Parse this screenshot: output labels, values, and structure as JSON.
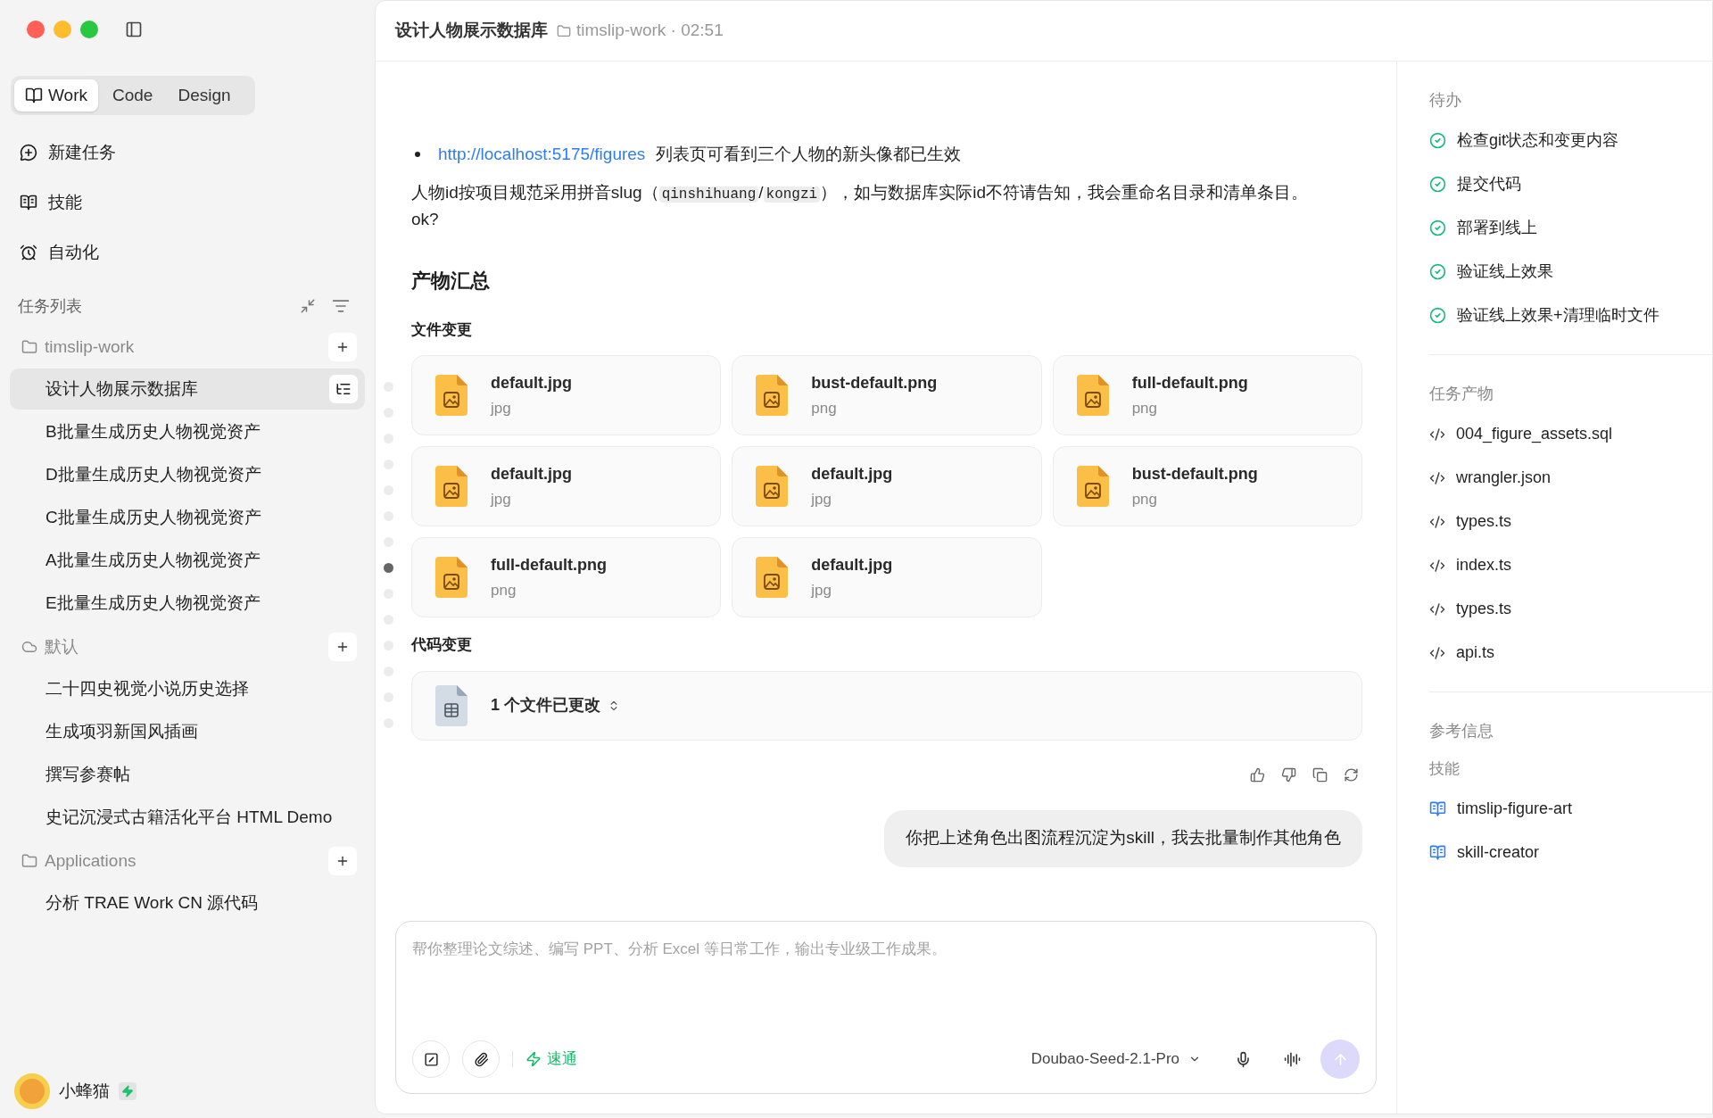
{
  "sidebar": {
    "tabs": [
      {
        "label": "Work",
        "selected": true
      },
      {
        "label": "Code",
        "selected": false
      },
      {
        "label": "Design",
        "selected": false
      }
    ],
    "nav": [
      {
        "kind": "new-task",
        "label": "新建任务"
      },
      {
        "kind": "skills",
        "label": "技能"
      },
      {
        "kind": "automation",
        "label": "自动化"
      }
    ],
    "task_list": {
      "title": "任务列表",
      "groups": [
        {
          "kind": "folder",
          "name": "timslip-work",
          "tasks": [
            {
              "title": "设计人物展示数据库",
              "selected": true
            },
            {
              "title": "B批量生成历史人物视觉资产",
              "selected": false
            },
            {
              "title": "D批量生成历史人物视觉资产",
              "selected": false
            },
            {
              "title": "C批量生成历史人物视觉资产",
              "selected": false
            },
            {
              "title": "A批量生成历史人物视觉资产",
              "selected": false
            },
            {
              "title": "E批量生成历史人物视觉资产",
              "selected": false
            }
          ]
        },
        {
          "kind": "cloud",
          "name": "默认",
          "tasks": [
            {
              "title": "二十四史视觉小说历史选择",
              "selected": false
            },
            {
              "title": "生成项羽新国风插画",
              "selected": false
            },
            {
              "title": "撰写参赛帖",
              "selected": false
            },
            {
              "title": "史记沉浸式古籍活化平台 HTML Demo",
              "selected": false
            }
          ]
        },
        {
          "kind": "folder",
          "name": "Applications",
          "tasks": [
            {
              "title": "分析 TRAE Work CN 源代码",
              "selected": false
            }
          ]
        }
      ]
    },
    "user": {
      "name": "小蜂猫"
    }
  },
  "header": {
    "title": "设计人物展示数据库",
    "project": "timslip-work · 02:51"
  },
  "timeline": [
    {
      "selected": false
    },
    {
      "selected": false
    },
    {
      "selected": false
    },
    {
      "selected": false
    },
    {
      "selected": false
    },
    {
      "selected": false
    },
    {
      "selected": false
    },
    {
      "selected": true
    },
    {
      "selected": false
    },
    {
      "selected": false
    },
    {
      "selected": false
    },
    {
      "selected": false
    },
    {
      "selected": false
    },
    {
      "selected": false
    }
  ],
  "message": {
    "bullet": {
      "link": "http://localhost:5175/figures",
      "text": "列表页可看到三个人物的新头像都已生效"
    },
    "paragraph": [
      {
        "kind": "text",
        "text": "人物id按项目规范采用拼音slug（"
      },
      {
        "kind": "code",
        "text": "qinshihuang"
      },
      {
        "kind": "text",
        "text": "/"
      },
      {
        "kind": "code",
        "text": "kongzi"
      },
      {
        "kind": "text",
        "text": "），如与数据库实际id不符请告知，我会重命名目录和清单条目。ok?"
      }
    ],
    "summary_title": "产物汇总",
    "files_title": "文件变更",
    "files": [
      {
        "name": "default.jpg",
        "type": "jpg"
      },
      {
        "name": "bust-default.png",
        "type": "png"
      },
      {
        "name": "full-default.png",
        "type": "png"
      },
      {
        "name": "default.jpg",
        "type": "jpg"
      },
      {
        "name": "default.jpg",
        "type": "jpg"
      },
      {
        "name": "bust-default.png",
        "type": "png"
      },
      {
        "name": "full-default.png",
        "type": "png"
      },
      {
        "name": "default.jpg",
        "type": "jpg"
      }
    ],
    "code_title": "代码变更",
    "code_change": "1 个文件已更改"
  },
  "user_message": "你把上述角色出图流程沉淀为skill，我去批量制作其他角色",
  "composer": {
    "placeholder": "帮你整理论文综述、编写 PPT、分析 Excel 等日常工作，输出专业级工作成果。",
    "mode": "速通",
    "model": "Doubao-Seed-2.1-Pro"
  },
  "right_panel": {
    "todo": {
      "title": "待办",
      "items": [
        {
          "label": "检查git状态和变更内容",
          "done": true
        },
        {
          "label": "提交代码",
          "done": true
        },
        {
          "label": "部署到线上",
          "done": true
        },
        {
          "label": "验证线上效果",
          "done": true
        },
        {
          "label": "验证线上效果+清理临时文件",
          "done": true
        }
      ]
    },
    "artifacts": {
      "title": "任务产物",
      "items": [
        "004_figure_assets.sql",
        "wrangler.json",
        "types.ts",
        "index.ts",
        "types.ts",
        "api.ts"
      ]
    },
    "references": {
      "title": "参考信息",
      "subtitle": "技能",
      "items": [
        "timslip-figure-art",
        "skill-creator"
      ]
    }
  }
}
